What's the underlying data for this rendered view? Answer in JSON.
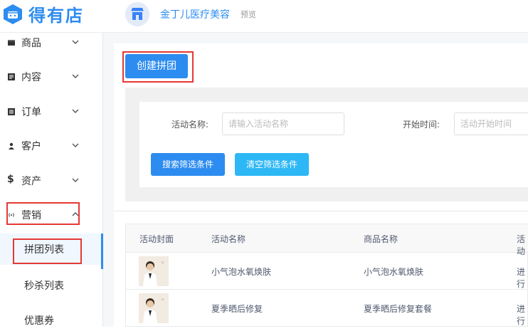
{
  "brand": {
    "name": "得有店"
  },
  "store": {
    "name": "金丁儿医疗美容",
    "preview": "预览"
  },
  "sidebar": {
    "items": [
      {
        "label": "商品"
      },
      {
        "label": "内容"
      },
      {
        "label": "订单"
      },
      {
        "label": "客户"
      },
      {
        "label": "资产"
      },
      {
        "label": "营销"
      }
    ],
    "subitems": [
      {
        "label": "拼团列表"
      },
      {
        "label": "秒杀列表"
      },
      {
        "label": "优惠券"
      }
    ]
  },
  "main": {
    "create_button": "创建拼团",
    "filter": {
      "name_label": "活动名称:",
      "name_placeholder": "请输入活动名称",
      "start_label": "开始时间:",
      "start_placeholder": "活动开始时间",
      "search_button": "搜索筛选条件",
      "clear_button": "清空筛选条件"
    },
    "table": {
      "columns": [
        "活动封面",
        "活动名称",
        "商品名称",
        "活动"
      ],
      "rows": [
        {
          "activity": "小气泡水氧焕肤",
          "product": "小气泡水氧焕肤",
          "status": "进行"
        },
        {
          "activity": "夏季晒后修复",
          "product": "夏季晒后修复套餐",
          "status": "进行"
        }
      ]
    }
  },
  "colors": {
    "accent": "#2d8cf0",
    "secondary": "#2db7f5",
    "highlight": "#e53935"
  }
}
